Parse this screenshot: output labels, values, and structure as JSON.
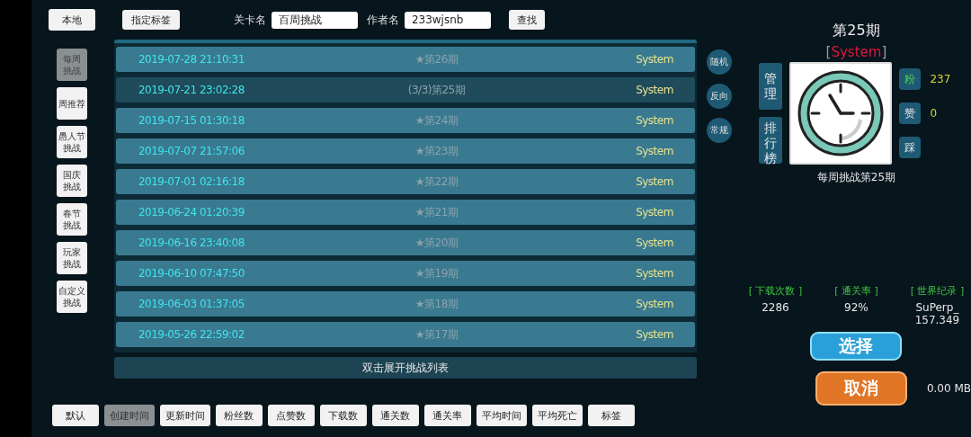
{
  "top_bar": {
    "local_button": "本地",
    "tag_button": "指定标签",
    "level_name_label": "关卡名",
    "level_name_value": "百周挑战",
    "author_label": "作者名",
    "author_value": "233wjsnb",
    "search_button": "查找"
  },
  "categories": [
    {
      "lines": [
        "每周",
        "挑战"
      ],
      "selected": true
    },
    {
      "lines": [
        "周推荐"
      ],
      "selected": false
    },
    {
      "lines": [
        "愚人节",
        "挑战"
      ],
      "selected": false
    },
    {
      "lines": [
        "国庆",
        "挑战"
      ],
      "selected": false
    },
    {
      "lines": [
        "春节",
        "挑战"
      ],
      "selected": false
    },
    {
      "lines": [
        "玩家",
        "挑战"
      ],
      "selected": false
    },
    {
      "lines": [
        "自定义",
        "挑战"
      ],
      "selected": false
    }
  ],
  "rows": [
    {
      "date": "2019-07-28 21:10:31",
      "title": "★第26期",
      "author": "System",
      "selected": false
    },
    {
      "date": "2019-07-21 23:02:28",
      "title": "(3/3)第25期",
      "author": "System",
      "selected": true
    },
    {
      "date": "2019-07-15 01:30:18",
      "title": "★第24期",
      "author": "System",
      "selected": false
    },
    {
      "date": "2019-07-07 21:57:06",
      "title": "★第23期",
      "author": "System",
      "selected": false
    },
    {
      "date": "2019-07-01 02:16:18",
      "title": "★第22期",
      "author": "System",
      "selected": false
    },
    {
      "date": "2019-06-24 01:20:39",
      "title": "★第21期",
      "author": "System",
      "selected": false
    },
    {
      "date": "2019-06-16 23:40:08",
      "title": "★第20期",
      "author": "System",
      "selected": false
    },
    {
      "date": "2019-06-10 07:47:50",
      "title": "★第19期",
      "author": "System",
      "selected": false
    },
    {
      "date": "2019-06-03 01:37:05",
      "title": "★第18期",
      "author": "System",
      "selected": false
    },
    {
      "date": "2019-05-26 22:59:02",
      "title": "★第17期",
      "author": "System",
      "selected": false
    }
  ],
  "expand_hint": "双击展开挑战列表",
  "sort_buttons": [
    {
      "label": "默认",
      "selected": false
    },
    {
      "label": "创建时间",
      "selected": true
    },
    {
      "label": "更新时间",
      "selected": false
    },
    {
      "label": "粉丝数",
      "selected": false
    },
    {
      "label": "点赞数",
      "selected": false
    },
    {
      "label": "下载数",
      "selected": false
    },
    {
      "label": "通关数",
      "selected": false
    },
    {
      "label": "通关率",
      "selected": false
    },
    {
      "label": "平均时间",
      "selected": false
    },
    {
      "label": "平均死亡",
      "selected": false
    },
    {
      "label": "标签",
      "selected": false
    }
  ],
  "modes": [
    "随机",
    "反向",
    "常规"
  ],
  "detail": {
    "title": "第25期",
    "author_open": "[",
    "author": "System",
    "author_close": "]",
    "manage_button": "管理",
    "ranking_button": "排行榜",
    "caption": "每周挑战第25期",
    "reactions": [
      {
        "label": "粉",
        "count": "237",
        "on": true
      },
      {
        "label": "赞",
        "count": "0",
        "on": false
      },
      {
        "label": "踩",
        "on": false
      }
    ]
  },
  "stats": [
    {
      "label": "[ 下载次数 ]",
      "value": "2286"
    },
    {
      "label": "[ 通关率 ]",
      "value": "92%"
    },
    {
      "label": "[ 世界纪录 ]",
      "value": "SuPerp_\n157.349"
    }
  ],
  "select_button": "选择",
  "cancel_button": "取消",
  "download_size": "0.00 MB"
}
